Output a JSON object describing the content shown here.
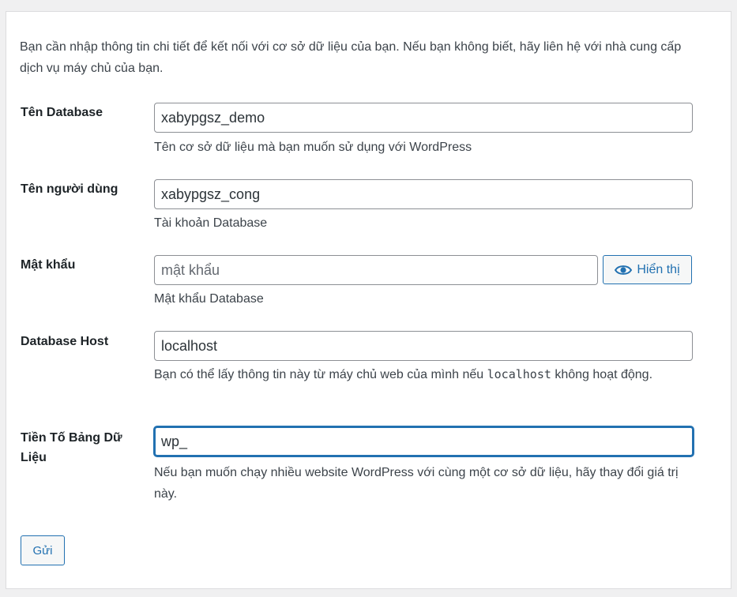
{
  "intro": "Bạn cần nhập thông tin chi tiết để kết nối với cơ sở dữ liệu của bạn. Nếu bạn không biết, hãy liên hệ với nhà cung cấp dịch vụ máy chủ của bạn.",
  "db_name": {
    "label": "Tên Database",
    "value": "xabypgsz_demo",
    "description": "Tên cơ sở dữ liệu mà bạn muốn sử dụng với WordPress"
  },
  "username": {
    "label": "Tên người dùng",
    "value": "xabypgsz_cong",
    "description": "Tài khoản Database"
  },
  "password": {
    "label": "Mật khẩu",
    "value": "",
    "placeholder": "mật khẩu",
    "show_button": "Hiển thị",
    "show_icon": "eye-icon",
    "description": "Mật khẩu Database"
  },
  "db_host": {
    "label": "Database Host",
    "value": "localhost",
    "description_before": "Bạn có thể lấy thông tin này từ máy chủ web của mình nếu ",
    "description_code": "localhost",
    "description_after": " không hoạt động."
  },
  "prefix": {
    "label": "Tiền Tố Bảng Dữ Liệu",
    "value": "wp_",
    "description": "Nếu bạn muốn chạy nhiều website WordPress với cùng một cơ sở dữ liệu, hãy thay đổi giá trị này."
  },
  "submit_label": "Gửi",
  "colors": {
    "accent": "#2271b1",
    "background": "#f0f0f1"
  }
}
